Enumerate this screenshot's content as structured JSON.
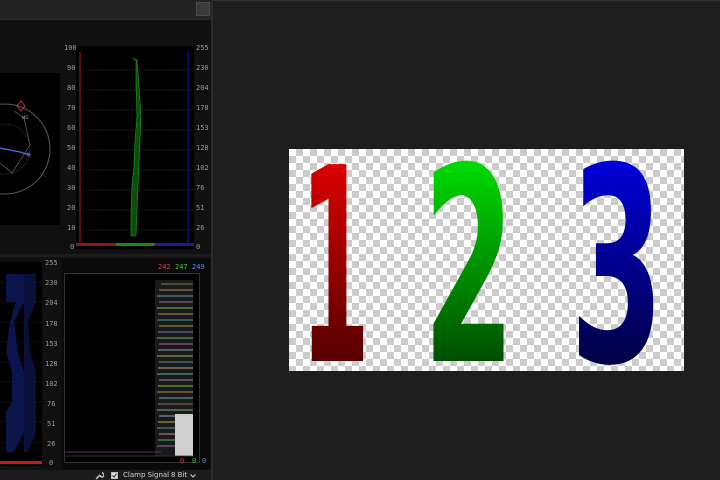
{
  "colors": {
    "red": "#e01010",
    "green": "#10d010",
    "blue": "#1a1ad8"
  },
  "parade_axis": {
    "left": [
      "100",
      "90",
      "80",
      "70",
      "60",
      "50",
      "40",
      "30",
      "20",
      "10",
      "0"
    ],
    "right": [
      "255",
      "230",
      "204",
      "178",
      "153",
      "128",
      "102",
      "76",
      "51",
      "26",
      "0"
    ]
  },
  "vectorscope": {
    "label": "MG"
  },
  "histogram_left_axis": [
    "255",
    "230",
    "204",
    "178",
    "153",
    "128",
    "102",
    "76",
    "51",
    "26",
    "0"
  ],
  "histogram_readout": {
    "top": {
      "r": "242",
      "g": "247",
      "b": "249"
    },
    "bottom": {
      "r": "0",
      "g": "0",
      "b": "0"
    }
  },
  "footer": {
    "clamp_label": "Clamp Signal",
    "bit_depth": "8 Bit"
  },
  "program": {
    "digits": [
      "1",
      "2",
      "3"
    ]
  }
}
